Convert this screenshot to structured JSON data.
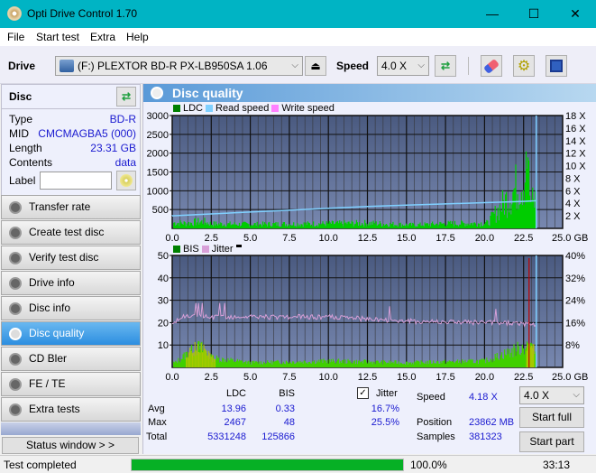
{
  "window": {
    "title": "Opti Drive Control 1.70",
    "minimize": "—",
    "maximize": "☐",
    "close": "✕"
  },
  "menu": [
    "File",
    "Start test",
    "Extra",
    "Help"
  ],
  "toolbar": {
    "drive_label": "Drive",
    "drive_value": "(F:)  PLEXTOR BD-R  PX-LB950SA 1.06",
    "speed_label": "Speed",
    "speed_value": "4.0 X"
  },
  "disc": {
    "header": "Disc",
    "rows": [
      {
        "label": "Type",
        "value": "BD-R"
      },
      {
        "label": "MID",
        "value": "CMCMAGBA5 (000)"
      },
      {
        "label": "Length",
        "value": "23.31 GB"
      },
      {
        "label": "Contents",
        "value": "data"
      }
    ],
    "label_field": "Label",
    "label_value": ""
  },
  "nav": [
    {
      "label": "Transfer rate",
      "active": false
    },
    {
      "label": "Create test disc",
      "active": false
    },
    {
      "label": "Verify test disc",
      "active": false
    },
    {
      "label": "Drive info",
      "active": false
    },
    {
      "label": "Disc info",
      "active": false
    },
    {
      "label": "Disc quality",
      "active": true
    },
    {
      "label": "CD Bler",
      "active": false
    },
    {
      "label": "FE / TE",
      "active": false
    },
    {
      "label": "Extra tests",
      "active": false
    }
  ],
  "status_window_button": "Status window > >",
  "panel_title": "Disc quality",
  "colors": {
    "ldc": "#00cc00",
    "read_speed": "#80d0ff",
    "write_speed": "#ff80ff",
    "bis": "#008000",
    "jitter": "#d8a0d8",
    "plot_bg_top": "#4a5a80",
    "plot_bg_bottom": "#7888b0",
    "progress": "#06b025"
  },
  "chart_data": [
    {
      "type": "bar",
      "title": "LDC / Read speed",
      "legend": [
        "LDC",
        "Read speed",
        "Write speed"
      ],
      "xlabel": "GB",
      "xlim": [
        0,
        25
      ],
      "x_ticks": [
        "0.0",
        "2.5",
        "5.0",
        "7.5",
        "10.0",
        "12.5",
        "15.0",
        "17.5",
        "20.0",
        "22.5",
        "25.0 GB"
      ],
      "ylim": [
        0,
        3000
      ],
      "y_ticks": [
        "3000",
        "2500",
        "2000",
        "1500",
        "1000",
        "500"
      ],
      "y2lim": [
        0,
        18
      ],
      "y2_ticks": [
        "18 X",
        "16 X",
        "14 X",
        "12 X",
        "10 X",
        "8 X",
        "6 X",
        "4 X",
        "2 X"
      ],
      "ldc_profile": [
        {
          "x": 0.2,
          "y": 250
        },
        {
          "x": 1.0,
          "y": 220
        },
        {
          "x": 1.5,
          "y": 280
        },
        {
          "x": 2.0,
          "y": 300
        },
        {
          "x": 2.5,
          "y": 200
        },
        {
          "x": 5.0,
          "y": 180
        },
        {
          "x": 9.0,
          "y": 200
        },
        {
          "x": 12.5,
          "y": 230
        },
        {
          "x": 15.5,
          "y": 150
        },
        {
          "x": 17.5,
          "y": 210
        },
        {
          "x": 20.2,
          "y": 230
        },
        {
          "x": 22.8,
          "y": 2467
        },
        {
          "x": 23.0,
          "y": 1200
        }
      ],
      "read_speed": [
        {
          "x": 0,
          "y": 2.0
        },
        {
          "x": 2.5,
          "y": 2.3
        },
        {
          "x": 5,
          "y": 2.6
        },
        {
          "x": 7.5,
          "y": 2.9
        },
        {
          "x": 10,
          "y": 3.2
        },
        {
          "x": 12.5,
          "y": 3.5
        },
        {
          "x": 15,
          "y": 3.7
        },
        {
          "x": 17.5,
          "y": 3.9
        },
        {
          "x": 20,
          "y": 4.1
        },
        {
          "x": 22.5,
          "y": 4.3
        },
        {
          "x": 23.3,
          "y": 4.4
        }
      ],
      "end_marker_gb": 23.31
    },
    {
      "type": "bar",
      "title": "BIS / Jitter",
      "legend": [
        "BIS",
        "Jitter"
      ],
      "xlabel": "GB",
      "xlim": [
        0,
        25
      ],
      "x_ticks": [
        "0.0",
        "2.5",
        "5.0",
        "7.5",
        "10.0",
        "12.5",
        "15.0",
        "17.5",
        "20.0",
        "22.5",
        "25.0 GB"
      ],
      "ylim": [
        0,
        50
      ],
      "y_ticks": [
        "50",
        "40",
        "30",
        "20",
        "10"
      ],
      "y2lim": [
        0,
        40
      ],
      "y2_ticks": [
        "40%",
        "32%",
        "24%",
        "16%",
        "8%"
      ],
      "bis_profile": [
        {
          "x": 0.2,
          "y": 3
        },
        {
          "x": 1.0,
          "y": 9
        },
        {
          "x": 1.8,
          "y": 13
        },
        {
          "x": 2.5,
          "y": 6
        },
        {
          "x": 5,
          "y": 3
        },
        {
          "x": 10,
          "y": 4
        },
        {
          "x": 15,
          "y": 3
        },
        {
          "x": 20,
          "y": 4
        },
        {
          "x": 22.8,
          "y": 14
        },
        {
          "x": 23.1,
          "y": 10
        }
      ],
      "jitter_profile": [
        {
          "x": 0,
          "y": 15
        },
        {
          "x": 0.5,
          "y": 18
        },
        {
          "x": 2.5,
          "y": 18
        },
        {
          "x": 5,
          "y": 18
        },
        {
          "x": 10,
          "y": 18
        },
        {
          "x": 15,
          "y": 16.5
        },
        {
          "x": 20,
          "y": 16
        },
        {
          "x": 23.2,
          "y": 15.5
        }
      ],
      "end_marker_gb": 23.31
    }
  ],
  "stats": {
    "col_ldc": "LDC",
    "col_bis": "BIS",
    "jitter_label": "Jitter",
    "jitter_checked": true,
    "rows": [
      {
        "label": "Avg",
        "ldc": "13.96",
        "bis": "0.33",
        "jitter": "16.7%"
      },
      {
        "label": "Max",
        "ldc": "2467",
        "bis": "48",
        "jitter": "25.5%"
      },
      {
        "label": "Total",
        "ldc": "5331248",
        "bis": "125866",
        "jitter": ""
      }
    ],
    "speed_label": "Speed",
    "speed_value": "4.18 X",
    "position_label": "Position",
    "position_value": "23862 MB",
    "samples_label": "Samples",
    "samples_value": "381323",
    "speed_select": "4.0 X",
    "start_full": "Start full",
    "start_part": "Start part"
  },
  "status": {
    "text": "Test completed",
    "progress_pct": 100,
    "progress_text": "100.0%",
    "time": "33:13"
  }
}
